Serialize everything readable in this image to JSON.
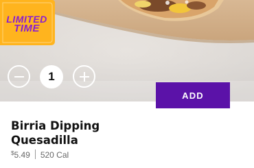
{
  "badge": {
    "line1": "LIMITED",
    "line2": "TIME"
  },
  "stepper": {
    "quantity": "1",
    "minus_icon": "minus-icon",
    "plus_icon": "plus-icon"
  },
  "add_button": {
    "label": "ADD"
  },
  "item": {
    "title": "Birria Dipping Quesadilla",
    "currency": "$",
    "price": "5.49",
    "calories": "520 Cal"
  },
  "colors": {
    "accent": "#5b12a8",
    "badge_orange": "#ffb41e",
    "badge_text": "#8a1fd0"
  }
}
